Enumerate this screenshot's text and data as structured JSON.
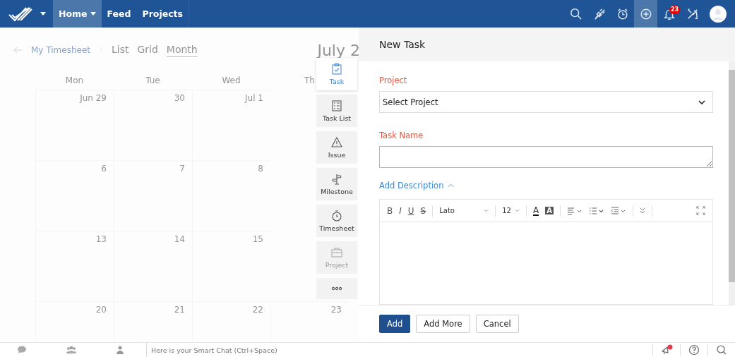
{
  "nav": {
    "tabs": [
      {
        "label": "Home",
        "selected": true,
        "dropdown": true
      },
      {
        "label": "Feed",
        "selected": false,
        "dropdown": false
      },
      {
        "label": "Projects",
        "selected": false,
        "dropdown": false
      }
    ],
    "icons": [
      {
        "kind": "search",
        "selected": false
      },
      {
        "kind": "plug",
        "selected": false
      },
      {
        "kind": "alarm",
        "selected": false
      },
      {
        "kind": "add",
        "selected": true
      },
      {
        "kind": "bell",
        "selected": false,
        "badge": "23"
      },
      {
        "kind": "tools",
        "selected": false
      }
    ]
  },
  "calendar": {
    "breadcrumb": "My Timesheet",
    "views": [
      {
        "label": "List",
        "selected": false
      },
      {
        "label": "Grid",
        "selected": false
      },
      {
        "label": "Month",
        "selected": true
      }
    ],
    "month_title": "July 2",
    "weekdays": [
      "Mon",
      "Tue",
      "Wed",
      "Th"
    ],
    "weeks": [
      [
        "Jun 29",
        "30",
        "Jul 1"
      ],
      [
        "6",
        "7",
        "8"
      ],
      [
        "13",
        "14",
        "15"
      ],
      [
        "20",
        "21",
        "22",
        "23"
      ]
    ]
  },
  "create_menu": [
    {
      "kind": "task",
      "label": "Task",
      "selected": true,
      "disabled": false
    },
    {
      "kind": "tasklist",
      "label": "Task List",
      "selected": false,
      "disabled": false
    },
    {
      "kind": "issue",
      "label": "Issue",
      "selected": false,
      "disabled": false
    },
    {
      "kind": "milestone",
      "label": "Milestone",
      "selected": false,
      "disabled": false
    },
    {
      "kind": "timesheet",
      "label": "Timesheet",
      "selected": false,
      "disabled": false
    },
    {
      "kind": "project",
      "label": "Project",
      "selected": false,
      "disabled": true
    },
    {
      "kind": "more",
      "selected": false,
      "disabled": false
    }
  ],
  "form": {
    "title": "New Task",
    "fields": [
      {
        "kind": "select",
        "label": "Project",
        "required": true,
        "value": "Select Project"
      },
      {
        "kind": "textarea",
        "label": "Task Name",
        "required": true
      }
    ],
    "description": {
      "label": "Add Description",
      "expanded": true,
      "toolbar": [
        {
          "kind": "bold",
          "label": "B"
        },
        {
          "kind": "italic",
          "label": "I"
        },
        {
          "kind": "underline",
          "label": "U"
        },
        {
          "kind": "strike",
          "label": "S"
        },
        {
          "kind": "font",
          "label": "Lato"
        },
        {
          "kind": "size",
          "label": "12"
        },
        {
          "kind": "color",
          "label": "A"
        },
        {
          "kind": "highlight",
          "label": "A"
        },
        {
          "kind": "align"
        },
        {
          "kind": "bullets"
        },
        {
          "kind": "indent"
        },
        {
          "kind": "more"
        },
        {
          "kind": "expand"
        }
      ]
    },
    "buttons": [
      {
        "label": "Add",
        "kind": "primary"
      },
      {
        "label": "Add More",
        "kind": "secondary"
      },
      {
        "label": "Cancel",
        "kind": "secondary"
      }
    ]
  },
  "bottom_bar": {
    "chat_placeholder": "Here is your Smart Chat (Ctrl+Space)",
    "icons": [
      {
        "kind": "announce",
        "alert": true
      },
      {
        "kind": "help",
        "alert": false
      },
      {
        "kind": "search",
        "alert": false
      }
    ]
  }
}
